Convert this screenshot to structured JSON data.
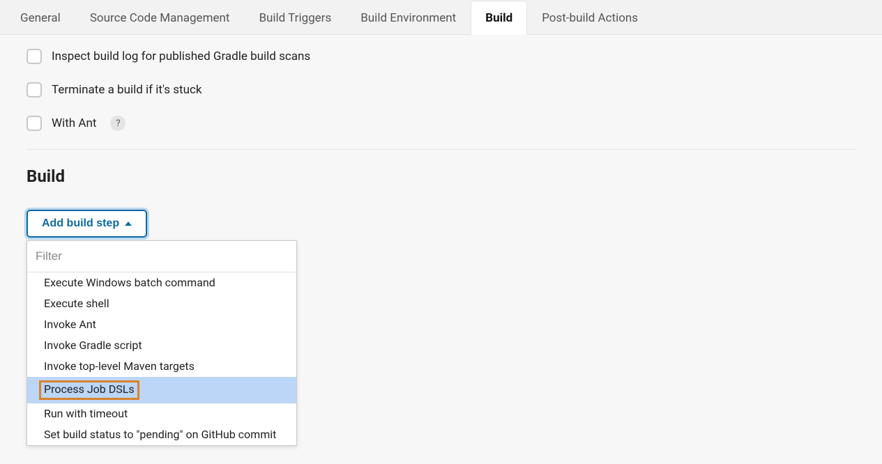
{
  "tabs": {
    "general": "General",
    "scm": "Source Code Management",
    "triggers": "Build Triggers",
    "env": "Build Environment",
    "build": "Build",
    "post": "Post-build Actions"
  },
  "env_options": {
    "inspect_log": "Inspect build log for published Gradle build scans",
    "terminate_stuck": "Terminate a build if it's stuck",
    "with_ant": "With Ant",
    "help_symbol": "?"
  },
  "build": {
    "title": "Build",
    "add_step_label": "Add build step",
    "filter_placeholder": "Filter",
    "options": [
      "Execute Windows batch command",
      "Execute shell",
      "Invoke Ant",
      "Invoke Gradle script",
      "Invoke top-level Maven targets",
      "Process Job DSLs",
      "Run with timeout",
      "Set build status to \"pending\" on GitHub commit"
    ],
    "highlighted_index": 5
  }
}
